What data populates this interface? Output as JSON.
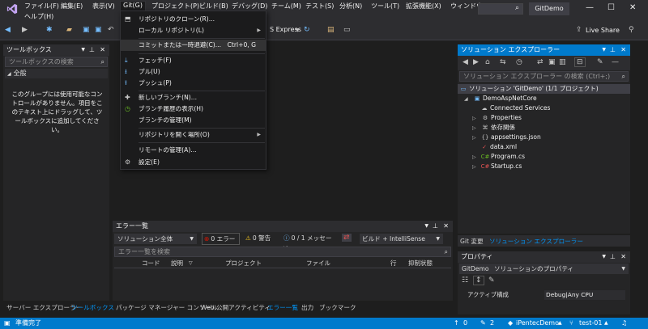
{
  "menubar": {
    "items": [
      "ファイル(F)",
      "編集(E)",
      "表示(V)",
      "Git(G)",
      "プロジェクト(P)",
      "ビルド(B)",
      "デバッグ(D)",
      "チーム(M)",
      "テスト(S)",
      "分析(N)",
      "ツール(T)",
      "拡張機能(X)",
      "ウィンドウ(W)"
    ],
    "help": "ヘルプ(H)",
    "solution_name": "GitDemo",
    "live_share": "Live Share"
  },
  "toolbar": {
    "run_target": "S Express"
  },
  "git_menu": {
    "items": [
      {
        "icon": "clone-icon",
        "label": "リポジトリのクローン(R)..."
      },
      {
        "icon": "",
        "label": "ローカル リポジトリ(L)",
        "submenu": true
      },
      {
        "icon": "",
        "label": "コミットまたは一時退避(C)...",
        "shortcut": "Ctrl+0, G",
        "highlighted": true
      },
      {
        "icon": "fetch-icon",
        "label": "フェッチ(F)"
      },
      {
        "icon": "pull-icon",
        "label": "プル(U)"
      },
      {
        "icon": "push-icon",
        "label": "プッシュ(P)"
      },
      {
        "icon": "new-branch-icon",
        "label": "新しいブランチ(N)..."
      },
      {
        "icon": "history-icon",
        "label": "ブランチ履歴の表示(H)"
      },
      {
        "icon": "",
        "label": "ブランチの管理(M)"
      },
      {
        "icon": "",
        "label": "リポジトリを開く場所(O)",
        "submenu": true
      },
      {
        "icon": "",
        "label": "リモートの管理(A)..."
      },
      {
        "icon": "gear-icon",
        "label": "設定(E)"
      }
    ]
  },
  "toolbox": {
    "title": "ツールボックス",
    "search_placeholder": "ツールボックスの検索",
    "group": "全般",
    "empty_message": "このグループには使用可能なコントロールがありません。項目をこのテキスト上にドラッグして、ツールボックスに追加してください。",
    "tabs": [
      "サーバー エクスプローラー",
      "ツールボックス"
    ]
  },
  "solution_explorer": {
    "title": "ソリューション エクスプローラー",
    "search_placeholder": "ソリューション エクスプローラー の検索 (Ctrl+;)",
    "solution_label": "ソリューション 'GitDemo' (1/1 プロジェクト)",
    "project": "DemoAspNetCore",
    "nodes": [
      "Connected Services",
      "Properties",
      "依存関係",
      "appsettings.json",
      "data.xml",
      "Program.cs",
      "Startup.cs"
    ],
    "bottom_tabs": [
      "Git 変更",
      "ソリューション エクスプローラー"
    ]
  },
  "properties": {
    "title": "プロパティ",
    "object": "GitDemo",
    "object_type": "ソリューションのプロパティ",
    "row_name": "アクティブ構成",
    "row_value": "Debug|Any CPU"
  },
  "error_list": {
    "title": "エラー一覧",
    "scope": "ソリューション全体",
    "errors": "0 エラー",
    "warnings": "0 警告",
    "messages": "0 / 1 メッセージ",
    "build_filter": "ビルド + IntelliSense",
    "search_placeholder": "エラー一覧を検索",
    "columns": [
      "コード",
      "説明",
      "プロジェクト",
      "ファイル",
      "行",
      "抑制状態"
    ]
  },
  "bottom_tabs": [
    "パッケージ マネージャー コンソール",
    "Web 公開アクティビティ",
    "エラー一覧",
    "出力",
    "ブックマーク"
  ],
  "statusbar": {
    "ready": "準備完了",
    "up_count": "0",
    "changes_count": "2",
    "repo": "iPentecDemo",
    "branch": "test-01"
  },
  "colors": {
    "accent": "#007acc",
    "background": "#1e1e1e",
    "chrome": "#2d2d30"
  }
}
